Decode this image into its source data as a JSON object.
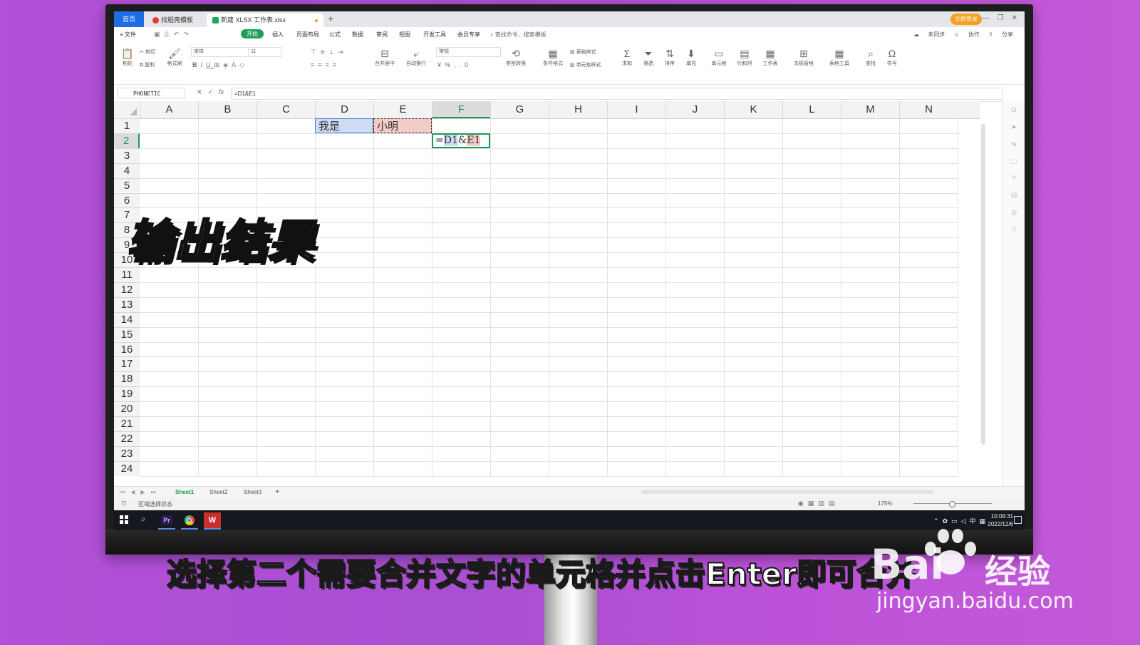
{
  "tabs": {
    "home": "首页",
    "template": "找稻壳模板",
    "document": "新建 XLSX 工作表.xlsx",
    "login": "立即登录"
  },
  "menu": {
    "file": "文件",
    "items": [
      "开始",
      "插入",
      "页面布局",
      "公式",
      "数据",
      "审阅",
      "视图",
      "开发工具",
      "会员专享"
    ],
    "active_index": 0,
    "search": "查找命令、搜索模板",
    "sync": "未同步",
    "collab": "协作",
    "share": "分享"
  },
  "ribbon": {
    "paste": "粘贴",
    "cut": "剪切",
    "copy": "复制",
    "format_painter": "格式刷",
    "font": "宋体",
    "font_size": "11",
    "merge": "合并居中",
    "wrap": "自动换行",
    "number_format": "常规",
    "convert": "类型转换",
    "cond_format": "条件格式",
    "table_style": "表格样式",
    "cell_style": "单元格样式",
    "sum": "求和",
    "filter": "筛选",
    "sort": "排序",
    "fill": "填充",
    "cell": "单元格",
    "row_col": "行和列",
    "worksheet": "工作表",
    "freeze": "冻结窗格",
    "table_tools": "表格工具",
    "find": "查找",
    "symbol": "符号"
  },
  "formula_bar": {
    "name_box": "PHONETIC",
    "fx": "fx",
    "formula": "=D1&E1"
  },
  "grid": {
    "columns": [
      "A",
      "B",
      "C",
      "D",
      "E",
      "F",
      "G",
      "H",
      "I",
      "J",
      "K",
      "L",
      "M",
      "N"
    ],
    "selected_column": "F",
    "rows": [
      "1",
      "2",
      "3",
      "4",
      "5",
      "6",
      "7",
      "8",
      "9",
      "10",
      "11",
      "12",
      "13",
      "14",
      "15",
      "16",
      "17",
      "18",
      "19",
      "20",
      "21",
      "22",
      "23",
      "24"
    ],
    "selected_row": "2",
    "cells": {
      "D1": "我是",
      "E1": "小明",
      "F2_eq": "=",
      "F2_ref1": "D1",
      "F2_amp": "&",
      "F2_ref2": "E1"
    }
  },
  "overlay_title": "输出结果",
  "sheets": {
    "tabs": [
      "Sheet1",
      "Sheet2",
      "Sheet3"
    ],
    "active": "Sheet1",
    "add": "+"
  },
  "status": {
    "mode": "区域选择状态",
    "zoom": "175%"
  },
  "taskbar": {
    "premiere": "Pr",
    "wps": "W",
    "time": "10:09:31",
    "date": "2022/12/6",
    "ime": "中"
  },
  "subtitle": "选择第二个需要合并文字的单元格并点击Enter即可合并",
  "watermark": {
    "brand_left": "Bai",
    "brand_right": "经验",
    "url": "jingyan.baidu.com"
  }
}
